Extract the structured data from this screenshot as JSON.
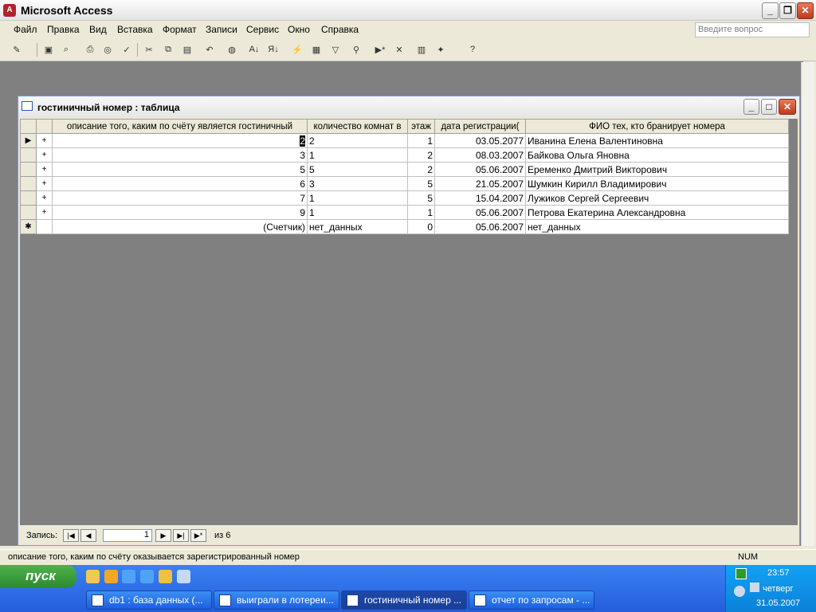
{
  "app": {
    "title": "Microsoft Access"
  },
  "menu": {
    "items": [
      "Файл",
      "Правка",
      "Вид",
      "Вставка",
      "Формат",
      "Записи",
      "Сервис",
      "Окно",
      "Справка"
    ],
    "help_placeholder": "Введите вопрос"
  },
  "toolbar": {
    "icons": [
      "design-view-icon",
      "save-icon",
      "search-file-icon",
      "print-icon",
      "print-preview-icon",
      "spelling-icon",
      "cut-icon",
      "copy-icon",
      "paste-icon",
      "undo-icon",
      "hyperlink-icon",
      "sort-asc-icon",
      "sort-desc-icon",
      "filter-selection-icon",
      "filter-form-icon",
      "apply-filter-icon",
      "find-icon",
      "new-record-icon",
      "delete-record-icon",
      "database-window-icon",
      "new-object-icon",
      "help-icon"
    ]
  },
  "window": {
    "title": "гостиничный номер : таблица",
    "columns": [
      "описание того, каким по счёту является гостиничный",
      "количество комнат в",
      "этаж",
      "дата регистрации(",
      "ФИО тех, кто бранирует номера"
    ],
    "rows": [
      {
        "marker": "▶",
        "expand": "+",
        "c1": "2",
        "c2": "2",
        "c3": "1",
        "c4": "03.05.2077",
        "c5": "Иванина Елена Валентиновна"
      },
      {
        "marker": "",
        "expand": "+",
        "c1": "3",
        "c2": "1",
        "c3": "2",
        "c4": "08.03.2007",
        "c5": "Байкова Ольга Яновна"
      },
      {
        "marker": "",
        "expand": "+",
        "c1": "5",
        "c2": "5",
        "c3": "2",
        "c4": "05.06.2007",
        "c5": "Еременко Дмитрий Викторович"
      },
      {
        "marker": "",
        "expand": "+",
        "c1": "6",
        "c2": "3",
        "c3": "5",
        "c4": "21.05.2007",
        "c5": "Шумкин Кирилл Владимирович"
      },
      {
        "marker": "",
        "expand": "+",
        "c1": "7",
        "c2": "1",
        "c3": "5",
        "c4": "15.04.2007",
        "c5": "Лужиков Сергей Сергеевич"
      },
      {
        "marker": "",
        "expand": "+",
        "c1": "9",
        "c2": "1",
        "c3": "1",
        "c4": "05.06.2007",
        "c5": "Петрова Екатерина Александровна"
      },
      {
        "marker": "✱",
        "expand": "",
        "c1": "(Счетчик)",
        "c2": "нет_данных",
        "c3": "0",
        "c4": "05.06.2007",
        "c5": "нет_данных"
      }
    ],
    "nav": {
      "label": "Запись:",
      "current": "1",
      "of_text": "из 6"
    }
  },
  "status": {
    "text": "описание того, каким по счёту оказывается зарегистрированный номер",
    "num": "NUM"
  },
  "taskbar": {
    "start": "пуск",
    "tasks": [
      "db1 : база данных (...",
      "выиграли в лотереи...",
      "гостиничный номер ...",
      "отчет по запросам - ..."
    ],
    "clock": {
      "time": "23:57",
      "day": "четверг",
      "date": "31.05.2007"
    }
  }
}
